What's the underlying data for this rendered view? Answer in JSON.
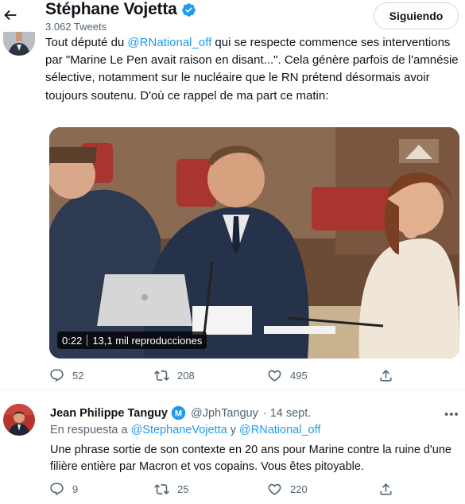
{
  "header": {
    "title": "Stéphane Vojetta",
    "tweet_count": "3.062 Tweets",
    "follow_label": "Siguiendo"
  },
  "tweet": {
    "text_before": "Tout député du ",
    "mention": "@RNational_off",
    "text_after": " qui se respecte commence ses interventions par \"Marine Le Pen avait raison en disant...\". Cela génère parfois de l'amnésie sélective, notamment sur le nucléaire que le RN prétend désormais avoir toujours soutenu. D'où ce rappel de ma part ce matin:",
    "video": {
      "duration": "0:22",
      "views": "13,1 mil reproducciones"
    },
    "actions": {
      "replies": "52",
      "retweets": "208",
      "likes": "495"
    }
  },
  "reply": {
    "name": "Jean Philippe Tanguy",
    "badge_letter": "M",
    "handle": "@JphTanguy",
    "date": "· 14 sept.",
    "reply_to_prefix": "En respuesta a ",
    "reply_to_user1": "@StephaneVojetta",
    "reply_to_join": " y ",
    "reply_to_user2": "@RNational_off",
    "text": "Une phrase sortie de son contexte en 20 ans pour Marine contre la ruine d'une filière entière par Macron et vos copains. Vous êtes pitoyable.",
    "actions": {
      "replies": "9",
      "retweets": "25",
      "likes": "220"
    }
  },
  "colors": {
    "accent": "#1d9bf0",
    "secondary_text": "#536471",
    "verified": "#1d9bf0"
  }
}
